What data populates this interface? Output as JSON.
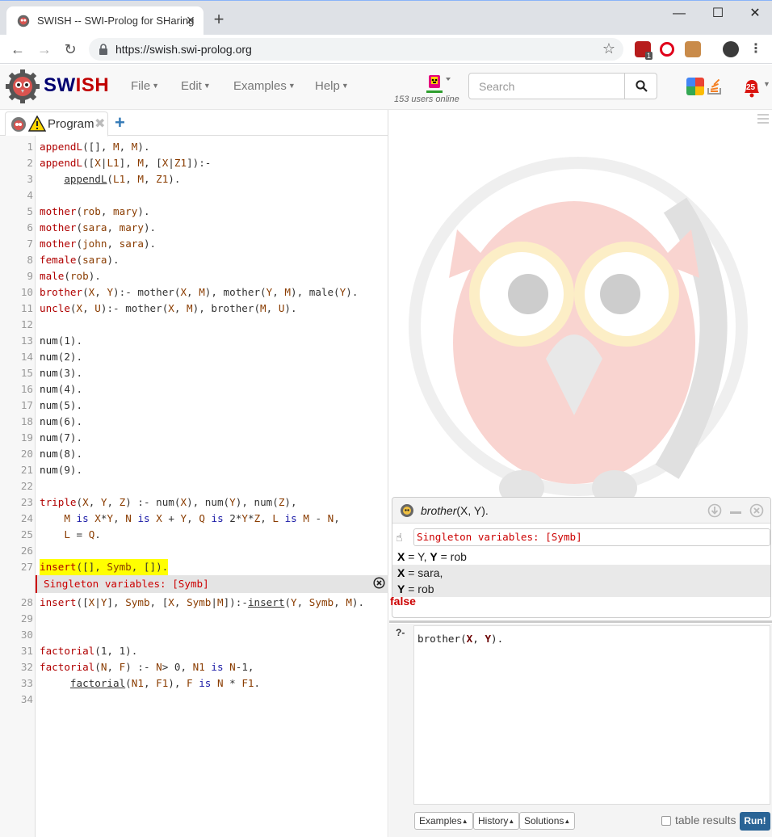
{
  "browser": {
    "tab_title": "SWISH -- SWI-Prolog for SHaring",
    "url": "https://swish.swi-prolog.org",
    "extension_badge": "1"
  },
  "swish": {
    "brand_sw": "SW",
    "brand_h": "ISH",
    "menus": [
      {
        "label": "File"
      },
      {
        "label": "Edit"
      },
      {
        "label": "Examples"
      },
      {
        "label": "Help"
      }
    ],
    "users_online": "153 users online",
    "search_placeholder": "Search",
    "notifications": "25"
  },
  "editor": {
    "tab_label": "Program",
    "lint_message": "Singleton variables: [Symb]",
    "line_numbers": [
      "1",
      "2",
      "3",
      "4",
      "5",
      "6",
      "7",
      "8",
      "9",
      "10",
      "11",
      "12",
      "13",
      "14",
      "15",
      "16",
      "17",
      "18",
      "19",
      "20",
      "21",
      "22",
      "23",
      "24",
      "25",
      "26",
      "27",
      "28",
      "29",
      "30",
      "31",
      "32",
      "33",
      "34"
    ]
  },
  "answer": {
    "query_functor": "brother",
    "query_args": "(X, Y).",
    "warning": "Singleton variables: [Symb]",
    "solutions": [
      {
        "text": " = Y, ",
        "var1": "X",
        "var2": "Y",
        "val": " = rob"
      },
      {
        "var": "X",
        "val": " = sara,"
      },
      {
        "var": "Y",
        "val": " = rob"
      }
    ],
    "false_label": "false"
  },
  "query": {
    "prompt": "?-",
    "text_pre": "brother(",
    "var1": "X",
    "sep": ", ",
    "var2": "Y",
    "text_post": ").",
    "buttons": {
      "examples": "Examples",
      "history": "History",
      "solutions": "Solutions"
    },
    "table_results": "table results",
    "run": "Run!"
  },
  "colors": {
    "brand_blue": "#000070",
    "brand_red": "#c00000",
    "run_button": "#2a6496",
    "error_red": "#cc0000"
  }
}
